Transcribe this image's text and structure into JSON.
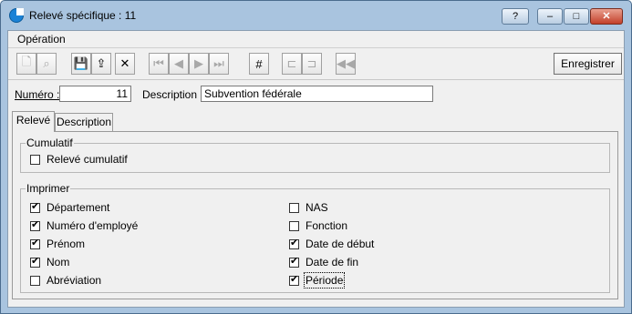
{
  "window": {
    "title": "Relevé spécifique : 11",
    "help": "?",
    "minimize": "–",
    "maximize": "□",
    "close": "✕"
  },
  "menu": {
    "items": [
      "Opération"
    ]
  },
  "toolbar": {
    "tools": [
      {
        "name": "new-icon",
        "glyph": "🗋",
        "disabled": true
      },
      {
        "name": "binoculars-icon",
        "glyph": "⌕",
        "disabled": true
      },
      {
        "name": "save-icon",
        "glyph": "💾",
        "disabled": false
      },
      {
        "name": "export-icon",
        "glyph": "⇪",
        "disabled": false
      },
      {
        "name": "delete-icon",
        "glyph": "✕",
        "disabled": false
      },
      {
        "name": "first-record-icon",
        "glyph": "⏮",
        "disabled": true
      },
      {
        "name": "previous-record-icon",
        "glyph": "◀",
        "disabled": true
      },
      {
        "name": "next-record-icon",
        "glyph": "▶",
        "disabled": true
      },
      {
        "name": "last-record-icon",
        "glyph": "⏭",
        "disabled": true
      },
      {
        "name": "renumber-icon",
        "glyph": "#",
        "disabled": false
      },
      {
        "name": "merge-left-icon",
        "glyph": "⊏",
        "disabled": true
      },
      {
        "name": "merge-right-icon",
        "glyph": "⊐",
        "disabled": true
      },
      {
        "name": "rewind-icon",
        "glyph": "◀◀",
        "disabled": true
      }
    ],
    "save_label": "Enregistrer"
  },
  "form": {
    "numero_label": "Numéro :",
    "numero_value": "11",
    "description_label": "Description :",
    "description_value": "Subvention fédérale"
  },
  "tabs": [
    {
      "label": "Relevé",
      "active": true
    },
    {
      "label": "Description",
      "active": false
    }
  ],
  "cumulatif": {
    "title": "Cumulatif",
    "options": [
      {
        "label": "Relevé cumulatif",
        "checked": false
      }
    ]
  },
  "imprimer": {
    "title": "Imprimer",
    "left": [
      {
        "label": "Département",
        "checked": true
      },
      {
        "label": "Numéro d'employé",
        "checked": true
      },
      {
        "label": "Prénom",
        "checked": true
      },
      {
        "label": "Nom",
        "checked": true
      },
      {
        "label": "Abréviation",
        "checked": false
      }
    ],
    "right": [
      {
        "label": "NAS",
        "checked": false
      },
      {
        "label": "Fonction",
        "checked": false
      },
      {
        "label": "Date de début",
        "checked": true
      },
      {
        "label": "Date de fin",
        "checked": true
      },
      {
        "label": "Période",
        "checked": true
      }
    ]
  }
}
